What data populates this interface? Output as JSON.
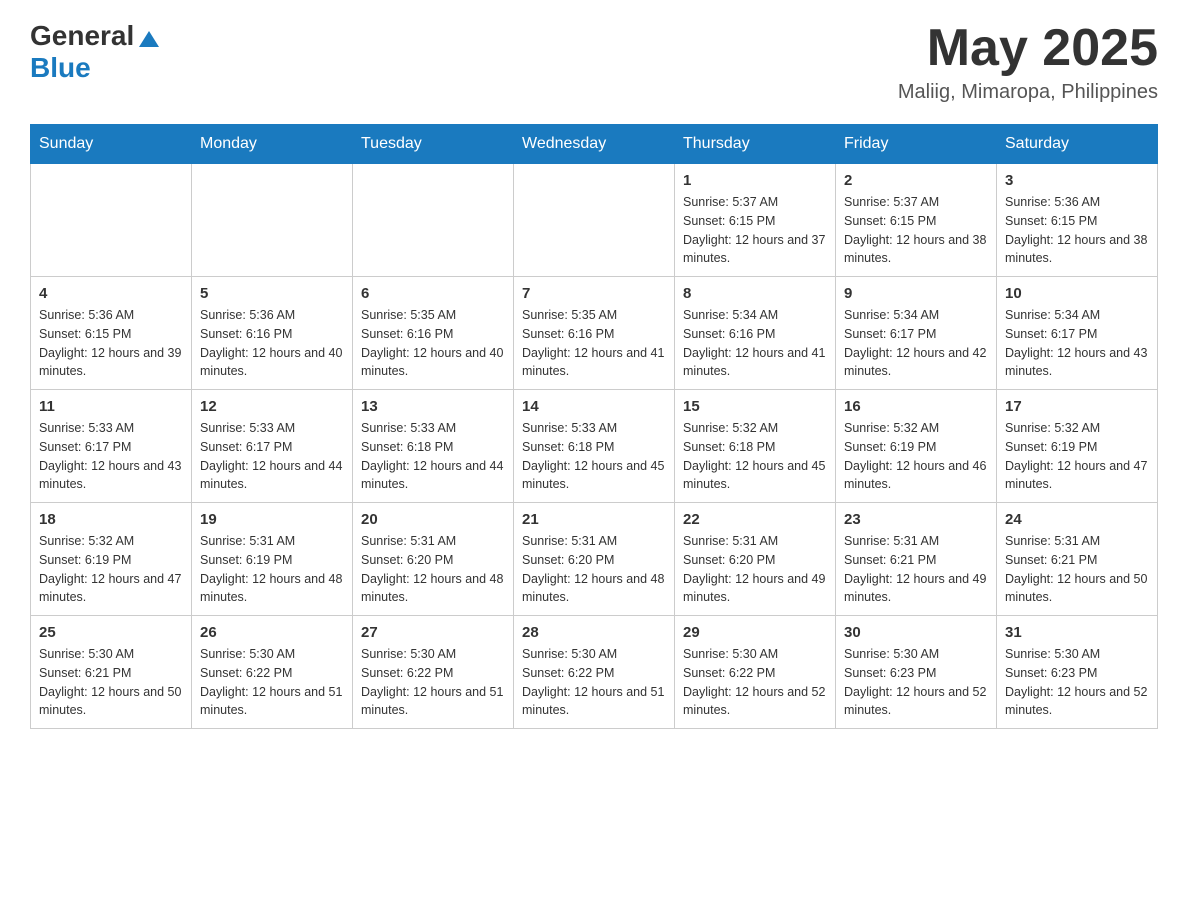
{
  "header": {
    "logo_general": "General",
    "logo_blue": "Blue",
    "month_title": "May 2025",
    "location": "Maliig, Mimaropa, Philippines"
  },
  "days_of_week": [
    "Sunday",
    "Monday",
    "Tuesday",
    "Wednesday",
    "Thursday",
    "Friday",
    "Saturday"
  ],
  "weeks": [
    {
      "days": [
        {
          "num": "",
          "info": ""
        },
        {
          "num": "",
          "info": ""
        },
        {
          "num": "",
          "info": ""
        },
        {
          "num": "",
          "info": ""
        },
        {
          "num": "1",
          "info": "Sunrise: 5:37 AM\nSunset: 6:15 PM\nDaylight: 12 hours and 37 minutes."
        },
        {
          "num": "2",
          "info": "Sunrise: 5:37 AM\nSunset: 6:15 PM\nDaylight: 12 hours and 38 minutes."
        },
        {
          "num": "3",
          "info": "Sunrise: 5:36 AM\nSunset: 6:15 PM\nDaylight: 12 hours and 38 minutes."
        }
      ]
    },
    {
      "days": [
        {
          "num": "4",
          "info": "Sunrise: 5:36 AM\nSunset: 6:15 PM\nDaylight: 12 hours and 39 minutes."
        },
        {
          "num": "5",
          "info": "Sunrise: 5:36 AM\nSunset: 6:16 PM\nDaylight: 12 hours and 40 minutes."
        },
        {
          "num": "6",
          "info": "Sunrise: 5:35 AM\nSunset: 6:16 PM\nDaylight: 12 hours and 40 minutes."
        },
        {
          "num": "7",
          "info": "Sunrise: 5:35 AM\nSunset: 6:16 PM\nDaylight: 12 hours and 41 minutes."
        },
        {
          "num": "8",
          "info": "Sunrise: 5:34 AM\nSunset: 6:16 PM\nDaylight: 12 hours and 41 minutes."
        },
        {
          "num": "9",
          "info": "Sunrise: 5:34 AM\nSunset: 6:17 PM\nDaylight: 12 hours and 42 minutes."
        },
        {
          "num": "10",
          "info": "Sunrise: 5:34 AM\nSunset: 6:17 PM\nDaylight: 12 hours and 43 minutes."
        }
      ]
    },
    {
      "days": [
        {
          "num": "11",
          "info": "Sunrise: 5:33 AM\nSunset: 6:17 PM\nDaylight: 12 hours and 43 minutes."
        },
        {
          "num": "12",
          "info": "Sunrise: 5:33 AM\nSunset: 6:17 PM\nDaylight: 12 hours and 44 minutes."
        },
        {
          "num": "13",
          "info": "Sunrise: 5:33 AM\nSunset: 6:18 PM\nDaylight: 12 hours and 44 minutes."
        },
        {
          "num": "14",
          "info": "Sunrise: 5:33 AM\nSunset: 6:18 PM\nDaylight: 12 hours and 45 minutes."
        },
        {
          "num": "15",
          "info": "Sunrise: 5:32 AM\nSunset: 6:18 PM\nDaylight: 12 hours and 45 minutes."
        },
        {
          "num": "16",
          "info": "Sunrise: 5:32 AM\nSunset: 6:19 PM\nDaylight: 12 hours and 46 minutes."
        },
        {
          "num": "17",
          "info": "Sunrise: 5:32 AM\nSunset: 6:19 PM\nDaylight: 12 hours and 47 minutes."
        }
      ]
    },
    {
      "days": [
        {
          "num": "18",
          "info": "Sunrise: 5:32 AM\nSunset: 6:19 PM\nDaylight: 12 hours and 47 minutes."
        },
        {
          "num": "19",
          "info": "Sunrise: 5:31 AM\nSunset: 6:19 PM\nDaylight: 12 hours and 48 minutes."
        },
        {
          "num": "20",
          "info": "Sunrise: 5:31 AM\nSunset: 6:20 PM\nDaylight: 12 hours and 48 minutes."
        },
        {
          "num": "21",
          "info": "Sunrise: 5:31 AM\nSunset: 6:20 PM\nDaylight: 12 hours and 48 minutes."
        },
        {
          "num": "22",
          "info": "Sunrise: 5:31 AM\nSunset: 6:20 PM\nDaylight: 12 hours and 49 minutes."
        },
        {
          "num": "23",
          "info": "Sunrise: 5:31 AM\nSunset: 6:21 PM\nDaylight: 12 hours and 49 minutes."
        },
        {
          "num": "24",
          "info": "Sunrise: 5:31 AM\nSunset: 6:21 PM\nDaylight: 12 hours and 50 minutes."
        }
      ]
    },
    {
      "days": [
        {
          "num": "25",
          "info": "Sunrise: 5:30 AM\nSunset: 6:21 PM\nDaylight: 12 hours and 50 minutes."
        },
        {
          "num": "26",
          "info": "Sunrise: 5:30 AM\nSunset: 6:22 PM\nDaylight: 12 hours and 51 minutes."
        },
        {
          "num": "27",
          "info": "Sunrise: 5:30 AM\nSunset: 6:22 PM\nDaylight: 12 hours and 51 minutes."
        },
        {
          "num": "28",
          "info": "Sunrise: 5:30 AM\nSunset: 6:22 PM\nDaylight: 12 hours and 51 minutes."
        },
        {
          "num": "29",
          "info": "Sunrise: 5:30 AM\nSunset: 6:22 PM\nDaylight: 12 hours and 52 minutes."
        },
        {
          "num": "30",
          "info": "Sunrise: 5:30 AM\nSunset: 6:23 PM\nDaylight: 12 hours and 52 minutes."
        },
        {
          "num": "31",
          "info": "Sunrise: 5:30 AM\nSunset: 6:23 PM\nDaylight: 12 hours and 52 minutes."
        }
      ]
    }
  ]
}
